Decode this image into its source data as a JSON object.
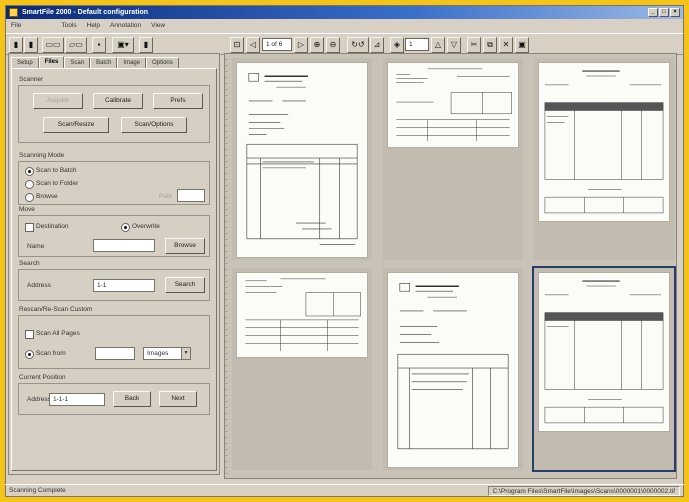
{
  "window": {
    "title": "SmartFile 2000 - Default configuration",
    "controls": [
      "_",
      "□",
      "×"
    ]
  },
  "menu": [
    "File",
    "Tools",
    "Help",
    "Annotation",
    "View"
  ],
  "toolbar": {
    "page_field": "1 of 6",
    "zoom_field": "1"
  },
  "tabs": [
    "Setup",
    "Files",
    "Scan",
    "Batch",
    "Image",
    "Options"
  ],
  "tabs_active_index": 1,
  "panel": {
    "scanner": {
      "legend": "Scanner",
      "buttons": [
        "Acquire",
        "Calibrate",
        "Prefs",
        "Scan/Resize",
        "Scan/Options"
      ]
    },
    "scanning_mode": {
      "legend": "Scanning Mode",
      "options": [
        "Scan to Batch",
        "Scan to Folder",
        "Browse"
      ],
      "selected_index": 0,
      "browse_label": "Path"
    },
    "move": {
      "legend": "Move",
      "option_a": "Destination",
      "option_b": "Overwrite",
      "name_label": "Name",
      "browse_button": "Browse"
    },
    "search": {
      "legend": "Search",
      "address_label": "Address",
      "address_value": "1-1",
      "button": "Search"
    },
    "rescan": {
      "legend": "Rescan/Re-Scan Custom",
      "check_all": "Scan All Pages",
      "scan_from_label": "Scan from",
      "range_value": "Images"
    },
    "current_position": {
      "legend": "Current Position",
      "address_label": "Address",
      "address_value": "1-1-1",
      "back_button": "Back",
      "next_button": "Next"
    }
  },
  "status": {
    "left": "Scanning Complete",
    "right": "C:\\Program Files\\SmartFile\\Images\\Scans\\0000001\\0000002.tif"
  }
}
